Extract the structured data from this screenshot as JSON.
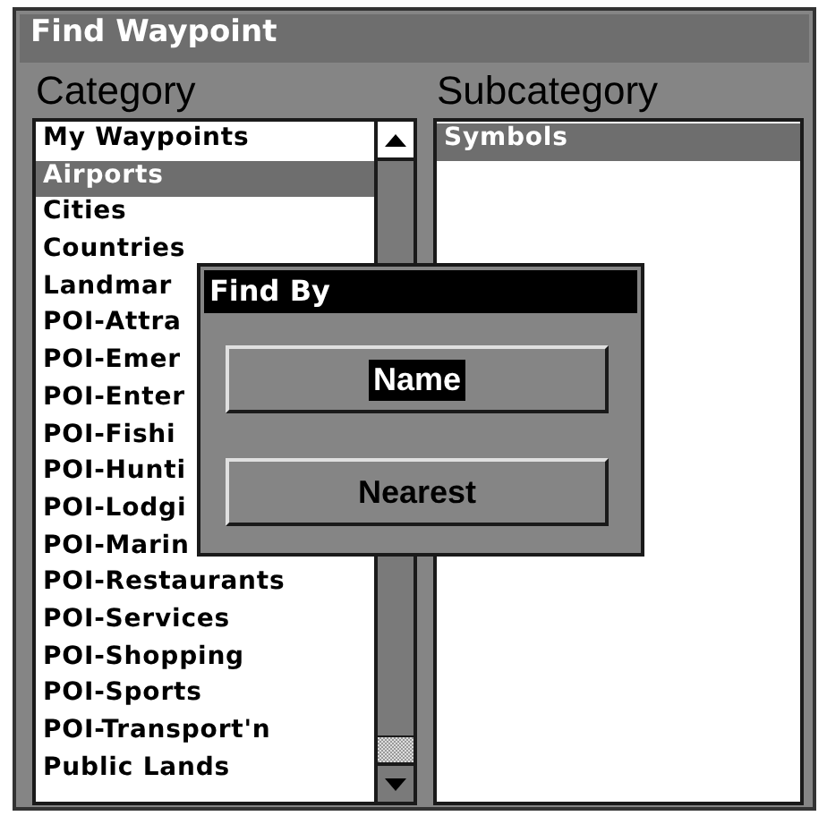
{
  "window": {
    "title": "Find Waypoint"
  },
  "category": {
    "heading": "Category",
    "items": [
      {
        "label": "My Waypoints",
        "selected": false
      },
      {
        "label": "Airports",
        "selected": true
      },
      {
        "label": "Cities",
        "selected": false
      },
      {
        "label": "Countries",
        "selected": false
      },
      {
        "label": "Landmar",
        "selected": false
      },
      {
        "label": "POI-Attra",
        "selected": false
      },
      {
        "label": "POI-Emer",
        "selected": false
      },
      {
        "label": "POI-Enter",
        "selected": false
      },
      {
        "label": "POI-Fishi",
        "selected": false
      },
      {
        "label": "POI-Hunti",
        "selected": false
      },
      {
        "label": "POI-Lodgi",
        "selected": false
      },
      {
        "label": "POI-Marin",
        "selected": false
      },
      {
        "label": "POI-Restaurants",
        "selected": false
      },
      {
        "label": "POI-Services",
        "selected": false
      },
      {
        "label": "POI-Shopping",
        "selected": false
      },
      {
        "label": "POI-Sports",
        "selected": false
      },
      {
        "label": "POI-Transport'n",
        "selected": false
      },
      {
        "label": "Public Lands",
        "selected": false
      }
    ]
  },
  "subcategory": {
    "heading": "Subcategory",
    "items": [
      {
        "label": "Symbols",
        "selected": true
      }
    ]
  },
  "dialog": {
    "title": "Find By",
    "buttons": [
      {
        "label": "Name",
        "selected": true
      },
      {
        "label": "Nearest",
        "selected": false
      }
    ]
  }
}
